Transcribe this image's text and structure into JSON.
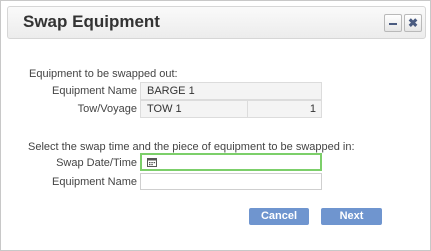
{
  "dialog": {
    "title": "Swap Equipment",
    "minimize_icon": "minimize-icon",
    "close_icon": "close-icon"
  },
  "swap_out": {
    "heading": "Equipment to be swapped out:",
    "equipment_name_label": "Equipment Name",
    "equipment_name_value": "BARGE 1",
    "tow_voyage_label": "Tow/Voyage",
    "tow_value": "TOW 1",
    "voyage_value": "1"
  },
  "swap_in": {
    "heading": "Select the swap time and the piece of equipment to be swapped in:",
    "swap_datetime_label": "Swap Date/Time",
    "swap_datetime_value": "",
    "calendar_icon": "calendar-icon",
    "equipment_name_label": "Equipment Name",
    "equipment_name_value": ""
  },
  "buttons": {
    "cancel": "Cancel",
    "next": "Next"
  },
  "colors": {
    "button_bg": "#6f95cf",
    "focus_border": "#7ccf6a",
    "title_icon": "#4a5b80"
  }
}
